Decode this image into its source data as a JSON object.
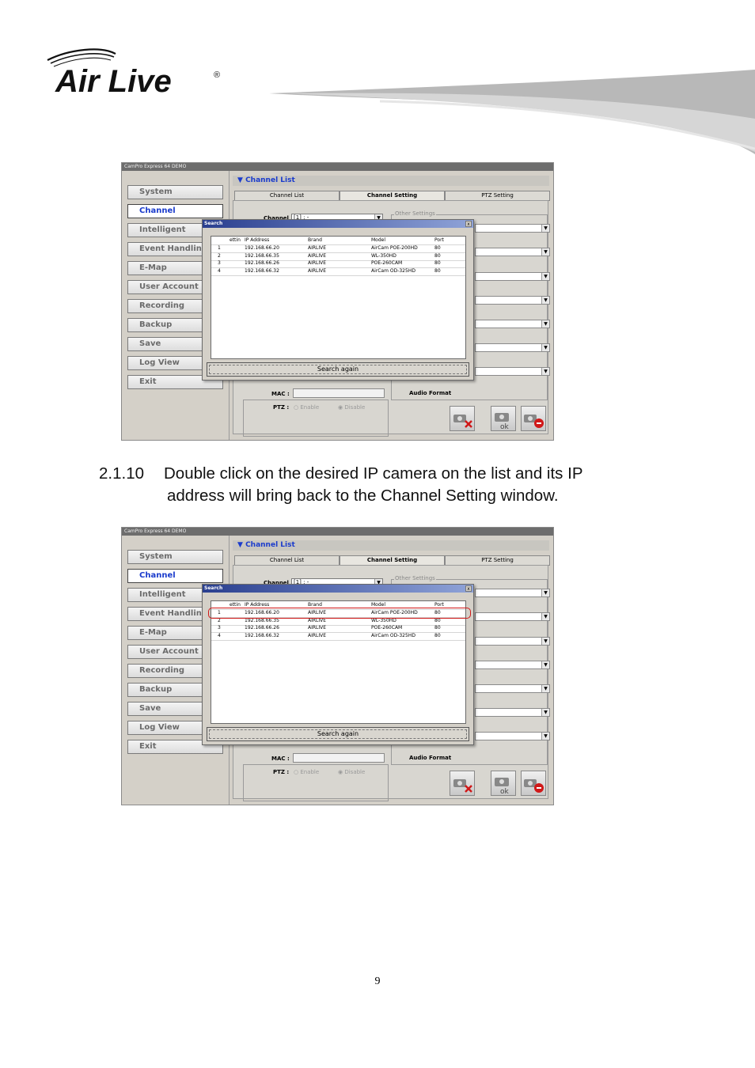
{
  "brand": {
    "logo_text": "Air Live",
    "registered": "®"
  },
  "screenshots": [
    {
      "window_title": "CamPro Express 64 DEMO",
      "nav": [
        "System",
        "Channel",
        "Intelligent",
        "Event Handling",
        "E-Map",
        "User Account",
        "Recording",
        "Backup",
        "Save",
        "Log View",
        "Exit"
      ],
      "active_nav": "Channel",
      "section_title": "Channel List",
      "tabs": [
        "Channel List",
        "Channel Setting",
        "PTZ Setting"
      ],
      "channel_label": "Channel",
      "channel_value": "[1] : -",
      "other_settings": "Other Settings",
      "mac_label": "MAC :",
      "ptz_label": "PTZ :",
      "ptz_enable": "Enable",
      "ptz_disable": "Disable",
      "audio_format": "Audio Format",
      "dialog": {
        "title": "Search",
        "close": "x",
        "headers": [
          "ettin",
          "IP Address",
          "Brand",
          "Model",
          "Port"
        ],
        "rows": [
          [
            "1",
            "192.168.66.20",
            "AIRLIVE",
            "AirCam POE-200HD",
            "80"
          ],
          [
            "2",
            "192.168.66.35",
            "AIRLIVE",
            "WL-350HD",
            "80"
          ],
          [
            "3",
            "192.168.66.26",
            "AIRLIVE",
            "POE-260CAM",
            "80"
          ],
          [
            "4",
            "192.168.66.32",
            "AIRLIVE",
            "AirCam OD-325HD",
            "80"
          ]
        ],
        "search_again": "Search again"
      }
    },
    {
      "window_title": "CamPro Express 64 DEMO",
      "nav": [
        "System",
        "Channel",
        "Intelligent",
        "Event Handling",
        "E-Map",
        "User Account",
        "Recording",
        "Backup",
        "Save",
        "Log View",
        "Exit"
      ],
      "active_nav": "Channel",
      "section_title": "Channel List",
      "tabs": [
        "Channel List",
        "Channel Setting",
        "PTZ Setting"
      ],
      "channel_label": "Channel",
      "channel_value": "[1] : -",
      "other_settings": "Other Settings",
      "mac_label": "MAC :",
      "ptz_label": "PTZ :",
      "ptz_enable": "Enable",
      "ptz_disable": "Disable",
      "audio_format": "Audio Format",
      "dialog": {
        "title": "Search",
        "close": "x",
        "headers": [
          "ettin",
          "IP Address",
          "Brand",
          "Model",
          "Port"
        ],
        "rows": [
          [
            "1",
            "192.168.66.20",
            "AIRLIVE",
            "AirCam POE-200HD",
            "80"
          ],
          [
            "2",
            "192.168.66.35",
            "AIRLIVE",
            "WL-350HD",
            "80"
          ],
          [
            "3",
            "192.168.66.26",
            "AIRLIVE",
            "POE-260CAM",
            "80"
          ],
          [
            "4",
            "192.168.66.32",
            "AIRLIVE",
            "AirCam OD-325HD",
            "80"
          ]
        ],
        "search_again": "Search again"
      },
      "highlighted_row": 1
    }
  ],
  "step": {
    "number": "2.1.10",
    "line1": "Double click on the desired IP camera on the list and its IP",
    "line2": "address will bring back to the Channel Setting window."
  },
  "page_number": "9"
}
